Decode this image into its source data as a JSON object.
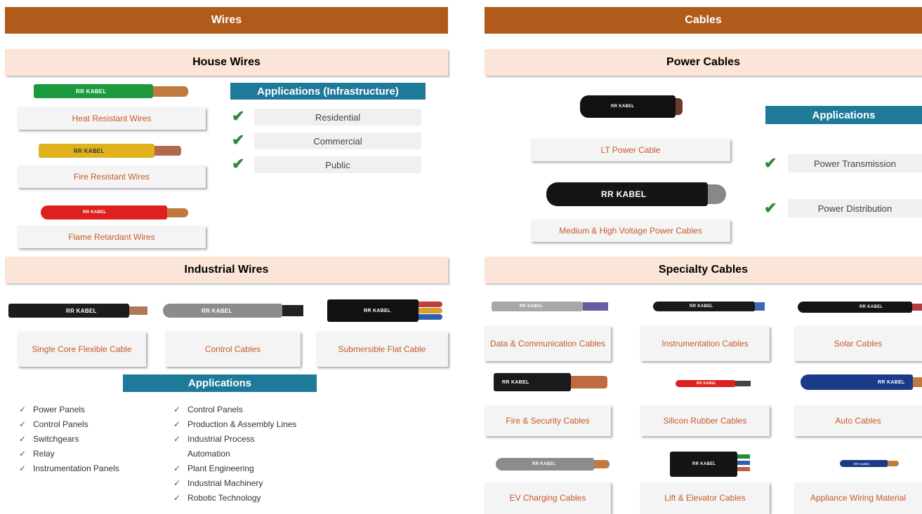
{
  "wires": {
    "title": "Wires",
    "house_wires": {
      "title": "House Wires",
      "items": [
        {
          "label": "Heat Resistant Wires",
          "brand": "RR KABEL",
          "color": "#1a9a3c"
        },
        {
          "label": "Fire Resistant Wires",
          "brand": "RR KABEL",
          "color": "#e0b21c"
        },
        {
          "label": "Flame Retardant Wires",
          "brand": "RR KABEL",
          "color": "#e02020"
        }
      ],
      "applications_title": "Applications (Infrastructure)",
      "applications": [
        "Residential",
        "Commercial",
        "Public"
      ]
    },
    "industrial_wires": {
      "title": "Industrial Wires",
      "items": [
        {
          "label": "Single Core Flexible Cable",
          "brand": "RR KABEL",
          "color": "#1c1c1c"
        },
        {
          "label": "Control Cables",
          "brand": "RR KABEL",
          "color": "#8c8c8c"
        },
        {
          "label": "Submersible Flat Cable",
          "brand": "RR KABEL",
          "color": "#111111"
        }
      ],
      "applications_title": "Applications",
      "applications_col1": [
        "Power Panels",
        "Control Panels",
        "Switchgears",
        "Relay",
        "Instrumentation Panels"
      ],
      "applications_col2": [
        "Control Panels",
        "Production & Assembly Lines",
        "Industrial Process Automation",
        "Plant Engineering",
        "Industrial Machinery",
        "Robotic Technology"
      ]
    }
  },
  "cables": {
    "title": "Cables",
    "power_cables": {
      "title": "Power Cables",
      "items": [
        {
          "label": "LT Power Cable",
          "brand": "RR KABEL"
        },
        {
          "label": "Medium & High Voltage Power Cables",
          "brand": "RR KABEL"
        }
      ],
      "applications_title": "Applications",
      "applications": [
        "Power Transmission",
        "Power Distribution"
      ]
    },
    "specialty_cables": {
      "title": "Specialty Cables",
      "items": [
        {
          "label": "Data & Communication Cables",
          "brand": "RR KABEL",
          "color": "#a8a8a8"
        },
        {
          "label": "Instrumentation Cables",
          "brand": "RR KABEL",
          "color": "#1a1a1a"
        },
        {
          "label": "Solar Cables",
          "brand": "RR KABEL",
          "color": "#141414"
        },
        {
          "label": "Fire & Security Cables",
          "brand": "RR KABEL",
          "color": "#1a1a1a"
        },
        {
          "label": "Silicon Rubber Cables",
          "brand": "RR KABEL",
          "color": "#e02020"
        },
        {
          "label": "Auto Cables",
          "brand": "RR KABEL",
          "color": "#1c3a8a"
        },
        {
          "label": "EV Charging Cables",
          "brand": "RR KABEL",
          "color": "#8c8c8c"
        },
        {
          "label": "Lift & Elevator Cables",
          "brand": "RR KABEL",
          "color": "#151515"
        },
        {
          "label": "Appliance Wiring Material",
          "brand": "RR KABEL",
          "color": "#1c3a8a"
        }
      ]
    }
  },
  "colors": {
    "header_brown": "#b05a1c",
    "peach": "#fbe5d6",
    "blue": "#1f7a9a",
    "label_text": "#c55a28",
    "check_green": "#2e8b2e"
  }
}
